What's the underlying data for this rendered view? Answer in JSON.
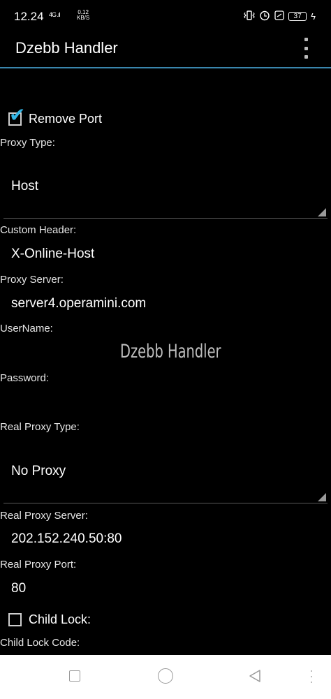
{
  "status_bar": {
    "time": "12.24",
    "signal": "4G .ıl",
    "net_speed_value": "0.12",
    "net_speed_unit": "KB/S",
    "battery": "37",
    "icons": [
      "vibrate-icon",
      "alarm-icon",
      "battery-icon",
      "charging-icon"
    ]
  },
  "app_bar": {
    "title": "Dzebb Handler",
    "menu_icon": "overflow-menu-icon"
  },
  "form": {
    "remove_port": {
      "label": "Remove Port",
      "checked": true
    },
    "proxy_type": {
      "label": "Proxy Type:",
      "value": "Host"
    },
    "custom_header": {
      "label": "Custom Header:",
      "value": "X-Online-Host"
    },
    "proxy_server": {
      "label": "Proxy Server:",
      "value": "server4.operamini.com"
    },
    "username": {
      "label": "UserName:",
      "value": ""
    },
    "password": {
      "label": "Password:",
      "value": ""
    },
    "real_proxy_type": {
      "label": "Real Proxy Type:",
      "value": "No Proxy"
    },
    "real_proxy_server": {
      "label": "Real Proxy Server:",
      "value": "202.152.240.50:80"
    },
    "real_proxy_port": {
      "label": "Real Proxy Port:",
      "value": "80"
    },
    "child_lock": {
      "label": "Child Lock:",
      "checked": false
    },
    "child_lock_code": {
      "label": "Child Lock Code:"
    }
  },
  "watermark": "Dzebb Handler",
  "colors": {
    "background": "#000000",
    "accent": "#33b5e5",
    "divider": "#3a86ad",
    "navbar": "#ffffff"
  }
}
